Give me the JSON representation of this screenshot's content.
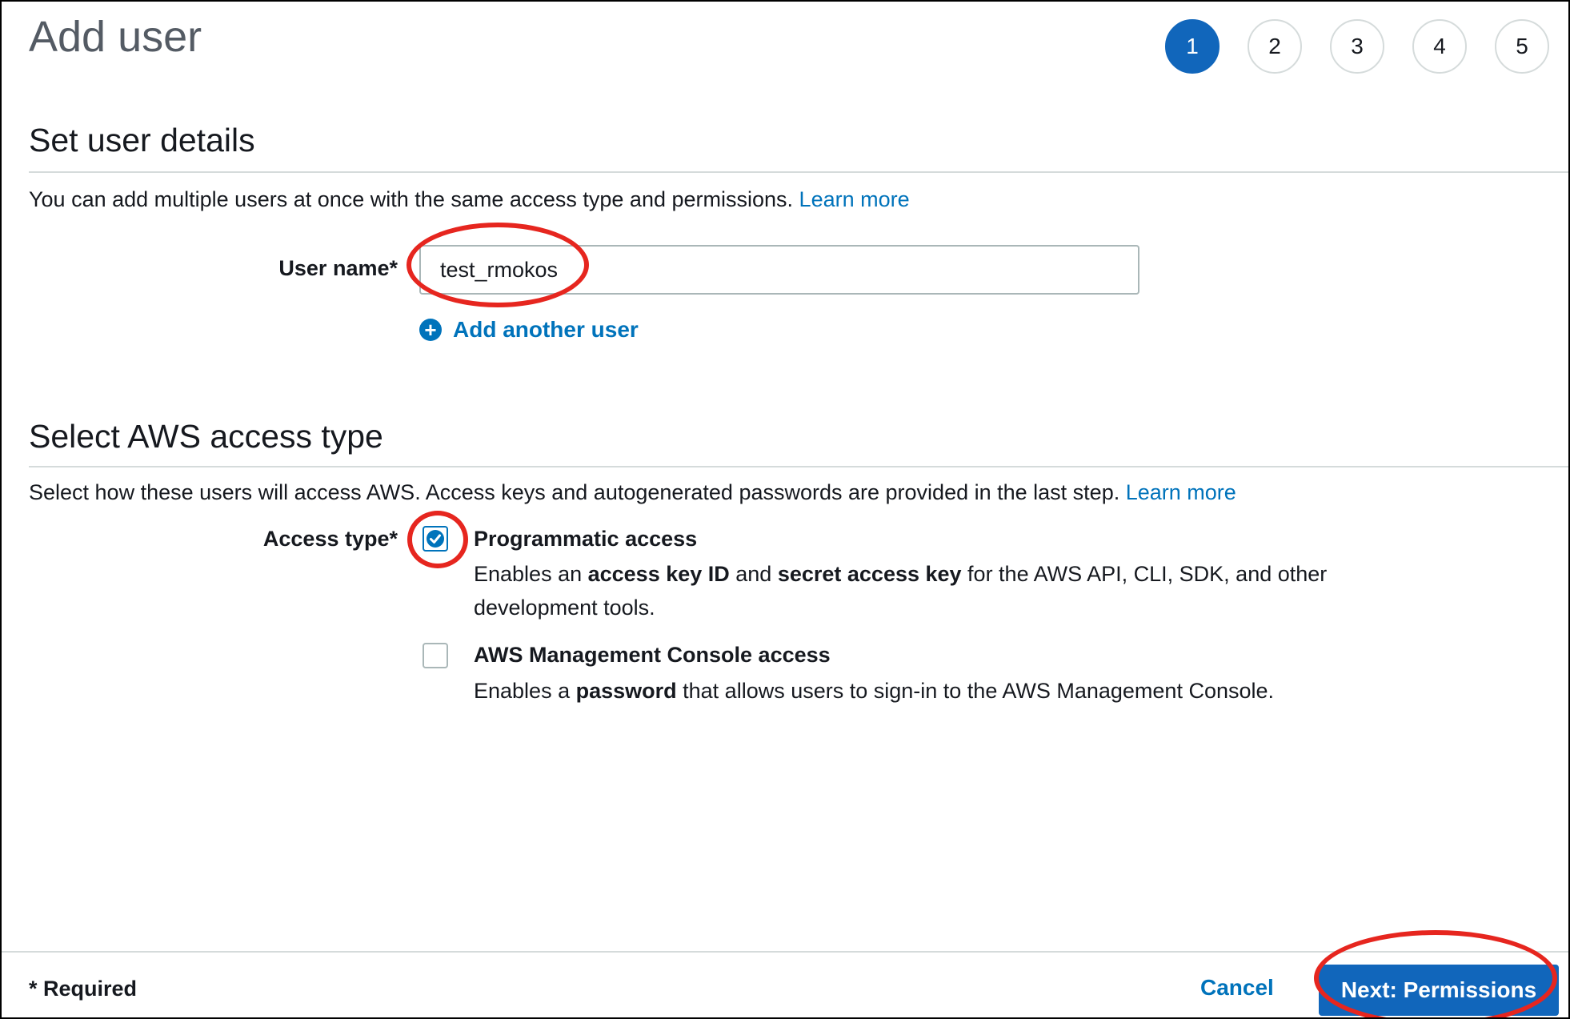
{
  "header": {
    "title": "Add user",
    "steps": [
      "1",
      "2",
      "3",
      "4",
      "5"
    ],
    "active_step": "1"
  },
  "user_details": {
    "section_title": "Set user details",
    "description": "You can add multiple users at once with the same access type and permissions.",
    "learn_more": "Learn more",
    "user_name_label": "User name*",
    "user_name_value": "test_rmokos",
    "add_another_user": "Add another user",
    "plus_icon": "+"
  },
  "access_type": {
    "section_title": "Select AWS access type",
    "description": "Select how these users will access AWS. Access keys and autogenerated passwords are provided in the last step.",
    "learn_more": "Learn more",
    "label": "Access type*",
    "options": [
      {
        "title": "Programmatic access",
        "checked": true,
        "desc_parts": [
          "Enables an ",
          "access key ID",
          " and ",
          "secret access key",
          " for the AWS API, CLI, SDK, and other development tools."
        ]
      },
      {
        "title": "AWS Management Console access",
        "checked": false,
        "desc_parts": [
          "Enables a ",
          "password",
          " that allows users to sign-in to the AWS Management Console."
        ]
      }
    ]
  },
  "footer": {
    "required_note": "* Required",
    "cancel": "Cancel",
    "next": "Next: Permissions"
  },
  "colors": {
    "accent": "#1166bb",
    "link": "#0073bb",
    "annotation": "#e6261f"
  },
  "icons": {
    "check": "check-icon",
    "plus": "plus-circle-icon"
  }
}
